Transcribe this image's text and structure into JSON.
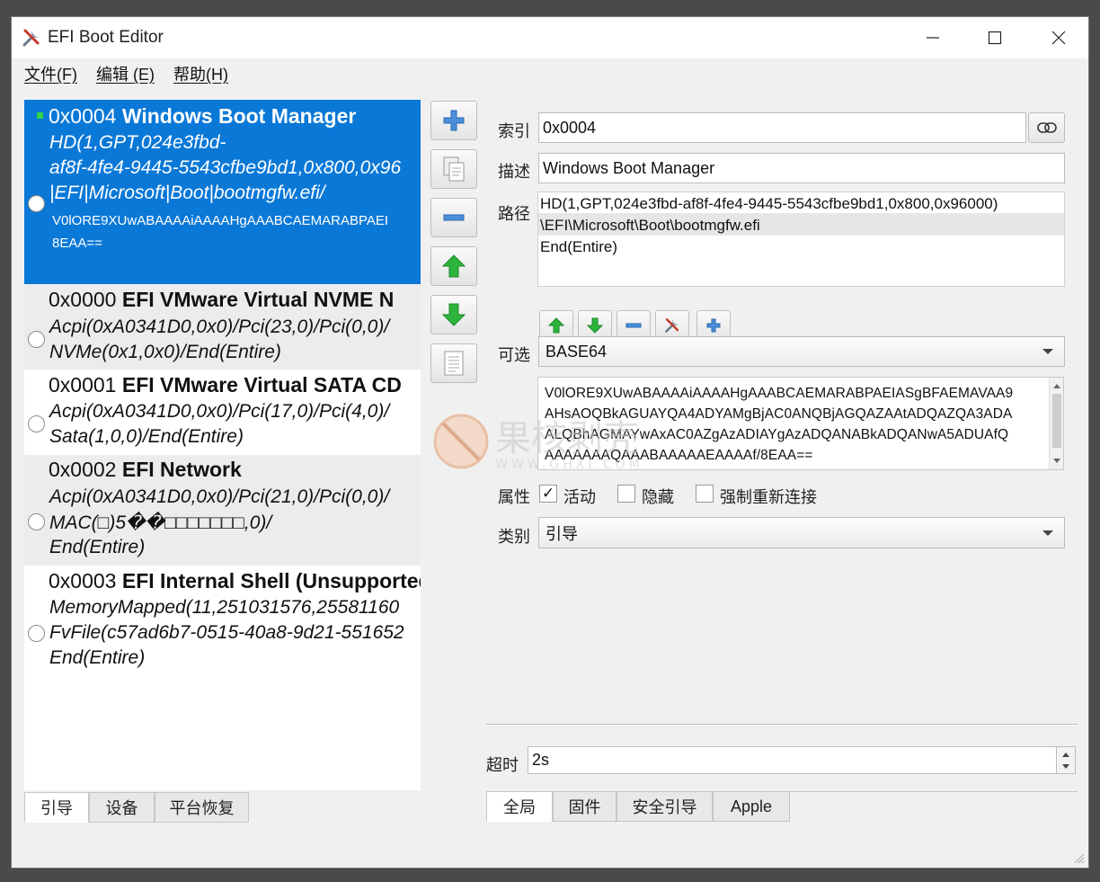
{
  "window": {
    "title": "EFI Boot Editor"
  },
  "menu": [
    {
      "label": "文件(F)"
    },
    {
      "label": "编辑 (E)"
    },
    {
      "label": "帮助(H)"
    }
  ],
  "boot_entries": [
    {
      "head_id": "0x0004",
      "head_name": "Windows Boot Manager",
      "lines": [
        "HD(1,GPT,024e3fbd-",
        "af8f-4fe4-9445-5543cfbe9bd1,0x800,0x96",
        "|EFI|Microsoft|Boot|bootmgfw.efi/"
      ],
      "small_lines": [
        "V0lORE9XUwABAAAAiAAAAHgAAABCAEMARABPAEI",
        "8EAA=="
      ],
      "selected": true
    },
    {
      "head_id": "0x0000",
      "head_name": "EFI VMware Virtual NVME N",
      "lines": [
        "Acpi(0xA0341D0,0x0)/Pci(23,0)/Pci(0,0)/",
        "NVMe(0x1,0x0)/End(Entire)"
      ]
    },
    {
      "head_id": "0x0001",
      "head_name": "EFI VMware Virtual SATA CD",
      "lines": [
        "Acpi(0xA0341D0,0x0)/Pci(17,0)/Pci(4,0)/",
        "Sata(1,0,0)/End(Entire)"
      ]
    },
    {
      "head_id": "0x0002",
      "head_name": "EFI Network",
      "lines": [
        "Acpi(0xA0341D0,0x0)/Pci(21,0)/Pci(0,0)/",
        "MAC(□)5��□□□□□□□,0)/",
        "End(Entire)"
      ]
    },
    {
      "head_id": "0x0003",
      "head_name": "EFI Internal Shell (Unsupported",
      "lines": [
        "MemoryMapped(11,251031576,25581160",
        "FvFile(c57ad6b7-0515-40a8-9d21-551652",
        "End(Entire)"
      ]
    }
  ],
  "left_tabs": [
    {
      "label": "引导"
    },
    {
      "label": "设备"
    },
    {
      "label": "平台恢复"
    }
  ],
  "form": {
    "index_label": "索引",
    "index_value": "0x0004",
    "desc_label": "描述",
    "desc_value": "Windows Boot Manager",
    "path_label": "路径",
    "path_lines": [
      "HD(1,GPT,024e3fbd-af8f-4fe4-9445-5543cfbe9bd1,0x800,0x96000)",
      "\\EFI\\Microsoft\\Boot\\bootmgfw.efi",
      "End(Entire)"
    ],
    "optional_label": "可选",
    "optional_value": "BASE64",
    "base64_lines": [
      "V0lORE9XUwABAAAAiAAAAHgAAABCAEMARABPAEIASgBFAEMAVAA9",
      "AHsAOQBkAGUAYQA4ADYAMgBjAC0ANQBjAGQAZAAtADQAZQA3ADA",
      "ALQBhAGMAYwAxAC0AZgAzADIAYgAzADQANABkADQANwA5ADUAfQ",
      "AAAAAAAQAAABAAAAAEAAAAf/8EAA=="
    ],
    "attr_label": "属性",
    "attr_active": "活动",
    "attr_hidden": "隐藏",
    "attr_reconnect": "强制重新连接",
    "category_label": "类别",
    "category_value": "引导",
    "timeout_label": "超时",
    "timeout_value": "2s"
  },
  "right_tabs": [
    {
      "label": "全局"
    },
    {
      "label": "固件"
    },
    {
      "label": "安全引导"
    },
    {
      "label": "Apple"
    }
  ],
  "watermark": {
    "text": "果核剥壳",
    "url": "WWW.GHXI.COM"
  },
  "colors": {
    "selection": "#0a78d7",
    "accent_green": "#2db43c",
    "accent_blue": "#3f86d4"
  }
}
